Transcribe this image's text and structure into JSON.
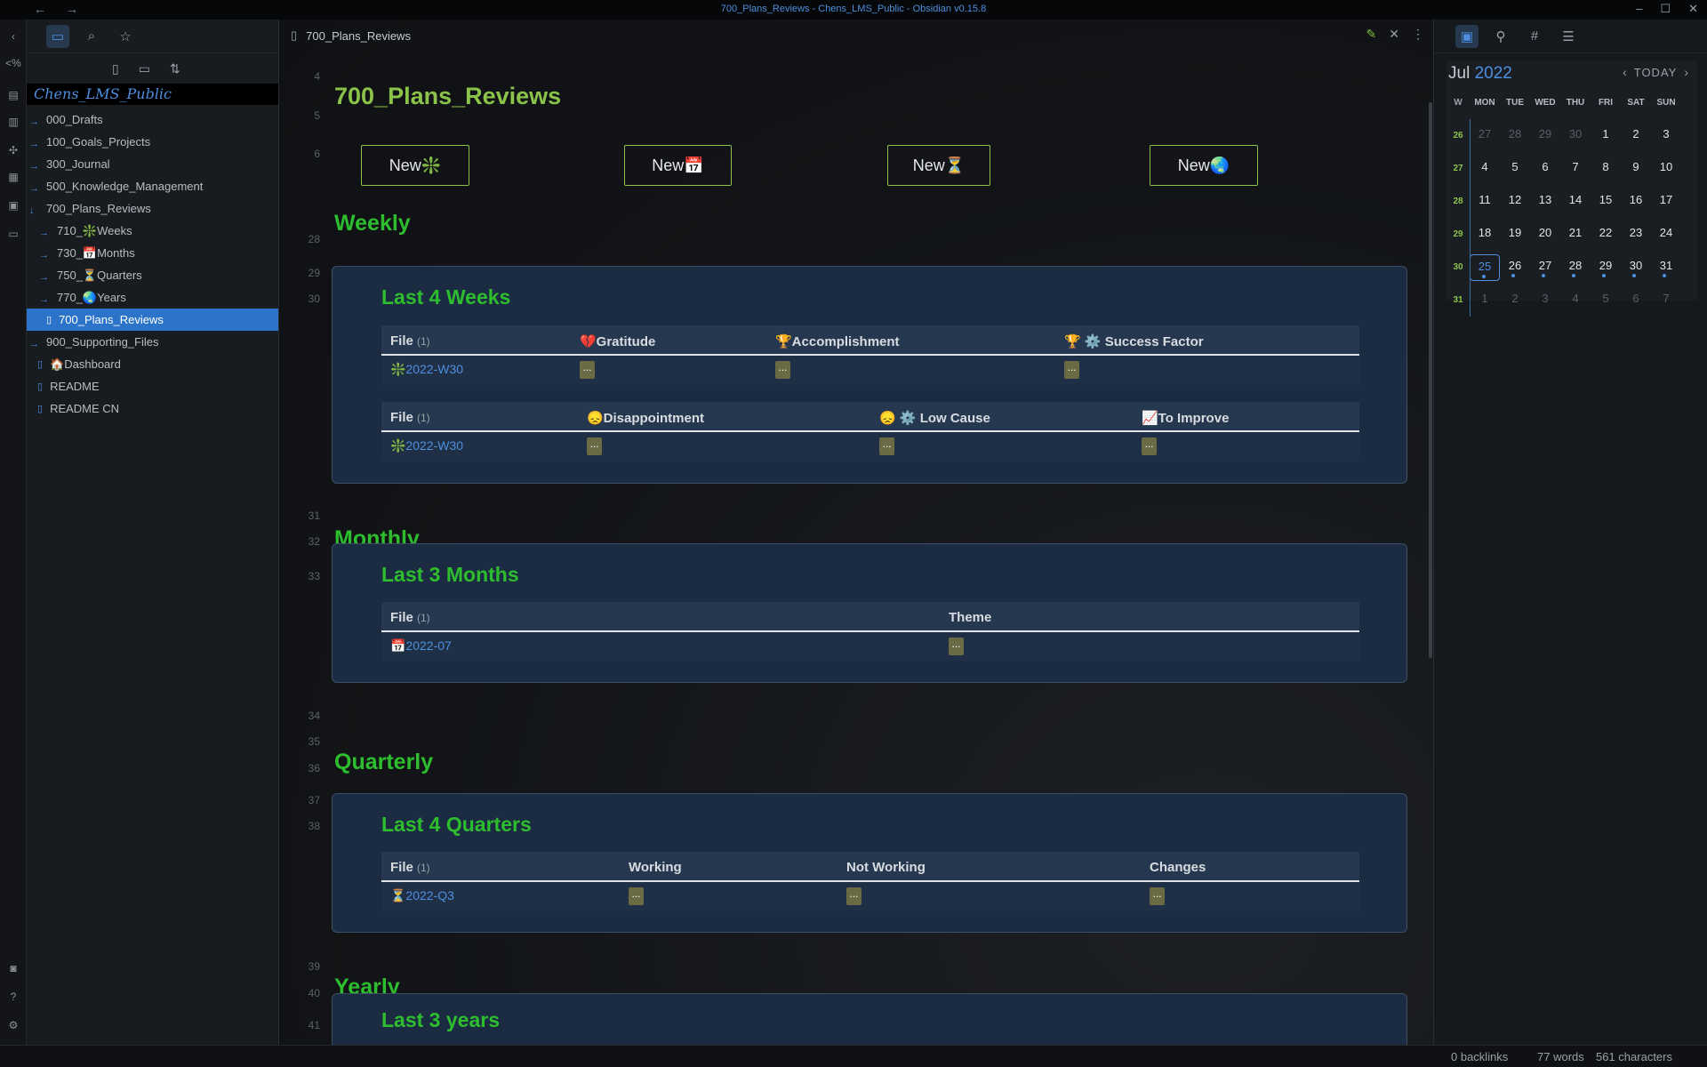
{
  "window": {
    "title": "700_Plans_Reviews - Chens_LMS_Public - Obsidian v0.15.8",
    "back": "←",
    "forward": "→",
    "minimize": "–",
    "maximize": "☐",
    "close": "✕"
  },
  "ribbon": [
    "code-icon",
    "calendar-icon",
    "template-icon",
    "graph-icon",
    "stack-icon",
    "table-icon",
    "date-icon",
    "vault-icon",
    "help-icon",
    "settings-icon"
  ],
  "sidebar": {
    "vault_name": "Chens_LMS_Public",
    "tree": [
      {
        "label": "000_Drafts",
        "type": "folder",
        "level": 0
      },
      {
        "label": "100_Goals_Projects",
        "type": "folder",
        "level": 0
      },
      {
        "label": "300_Journal",
        "type": "folder",
        "level": 0
      },
      {
        "label": "500_Knowledge_Management",
        "type": "folder",
        "level": 0
      },
      {
        "label": "700_Plans_Reviews",
        "type": "folder-open",
        "level": 0
      },
      {
        "label": "710_❇️Weeks",
        "type": "folder",
        "level": 1
      },
      {
        "label": "730_📅Months",
        "type": "folder",
        "level": 1
      },
      {
        "label": "750_⏳Quarters",
        "type": "folder",
        "level": 1
      },
      {
        "label": "770_🌏Years",
        "type": "folder",
        "level": 1
      },
      {
        "label": "700_Plans_Reviews",
        "type": "file-active",
        "level": 1
      },
      {
        "label": "900_Supporting_Files",
        "type": "folder",
        "level": 0
      },
      {
        "label": "🏠Dashboard",
        "type": "file",
        "level": 0
      },
      {
        "label": "README",
        "type": "file",
        "level": 0
      },
      {
        "label": "README CN",
        "type": "file",
        "level": 0
      }
    ]
  },
  "main": {
    "tab_title": "700_Plans_Reviews",
    "line_numbers": [
      "4",
      "5",
      "6",
      "28",
      "29",
      "30",
      "31",
      "32",
      "33",
      "34",
      "35",
      "36",
      "37",
      "38",
      "39",
      "40",
      "41"
    ],
    "heading": "700_Plans_Reviews",
    "buttons": [
      "New❇️",
      "New📅",
      "New⏳",
      "New🌏"
    ],
    "sections": {
      "weekly": "Weekly",
      "monthly": "Monthly",
      "quarterly": "Quarterly",
      "yearly": "Yearly"
    },
    "weeks_card": {
      "title": "Last 4 Weeks",
      "table1": {
        "headers": [
          "File",
          "💔Gratitude",
          "🏆Accomplishment",
          "🏆 ⚙️ Success Factor"
        ],
        "count": "(1)",
        "row": {
          "file": "❇️2022-W30",
          "cells": [
            "...",
            "...",
            "..."
          ]
        }
      },
      "table2": {
        "headers": [
          "File",
          "😞Disappointment",
          "😞 ⚙️ Low Cause",
          "📈To Improve"
        ],
        "count": "(1)",
        "row": {
          "file": "❇️2022-W30",
          "cells": [
            "...",
            "...",
            "..."
          ]
        }
      }
    },
    "months_card": {
      "title": "Last 3 Months",
      "headers": [
        "File",
        "Theme"
      ],
      "count": "(1)",
      "row": {
        "file": "📅2022-07",
        "cells": [
          "..."
        ]
      }
    },
    "quarters_card": {
      "title": "Last 4 Quarters",
      "headers": [
        "File",
        "Working",
        "Not Working",
        "Changes"
      ],
      "count": "(1)",
      "row": {
        "file": "⏳2022-Q3",
        "cells": [
          "...",
          "...",
          "..."
        ]
      }
    },
    "years_card": {
      "title": "Last 3 years"
    }
  },
  "calendar": {
    "month": "Jul",
    "year": "2022",
    "today_label": "TODAY",
    "dow": [
      "W",
      "MON",
      "TUE",
      "WED",
      "THU",
      "FRI",
      "SAT",
      "SUN"
    ],
    "weeks": [
      {
        "wk": "26",
        "days": [
          "27",
          "28",
          "29",
          "30",
          "1",
          "2",
          "3"
        ],
        "dim": [
          true,
          true,
          true,
          true,
          false,
          false,
          false
        ]
      },
      {
        "wk": "27",
        "days": [
          "4",
          "5",
          "6",
          "7",
          "8",
          "9",
          "10"
        ],
        "dim": [
          false,
          false,
          false,
          false,
          false,
          false,
          false
        ]
      },
      {
        "wk": "28",
        "days": [
          "11",
          "12",
          "13",
          "14",
          "15",
          "16",
          "17"
        ],
        "dim": [
          false,
          false,
          false,
          false,
          false,
          false,
          false
        ]
      },
      {
        "wk": "29",
        "days": [
          "18",
          "19",
          "20",
          "21",
          "22",
          "23",
          "24"
        ],
        "dim": [
          false,
          false,
          false,
          false,
          false,
          false,
          false
        ]
      },
      {
        "wk": "30",
        "days": [
          "25",
          "26",
          "27",
          "28",
          "29",
          "30",
          "31"
        ],
        "dim": [
          false,
          false,
          false,
          false,
          false,
          false,
          false
        ],
        "dots": true
      },
      {
        "wk": "31",
        "days": [
          "1",
          "2",
          "3",
          "4",
          "5",
          "6",
          "7"
        ],
        "dim": [
          true,
          true,
          true,
          true,
          true,
          true,
          true
        ]
      }
    ],
    "today": "25"
  },
  "status": {
    "backlinks": "0 backlinks",
    "words": "77 words",
    "chars": "561 characters"
  },
  "colors": {
    "accent": "#4d8fe0",
    "heading_green": "#2ebd2e",
    "title_green": "#8bc34a",
    "card_bg": "#1a2b42"
  }
}
